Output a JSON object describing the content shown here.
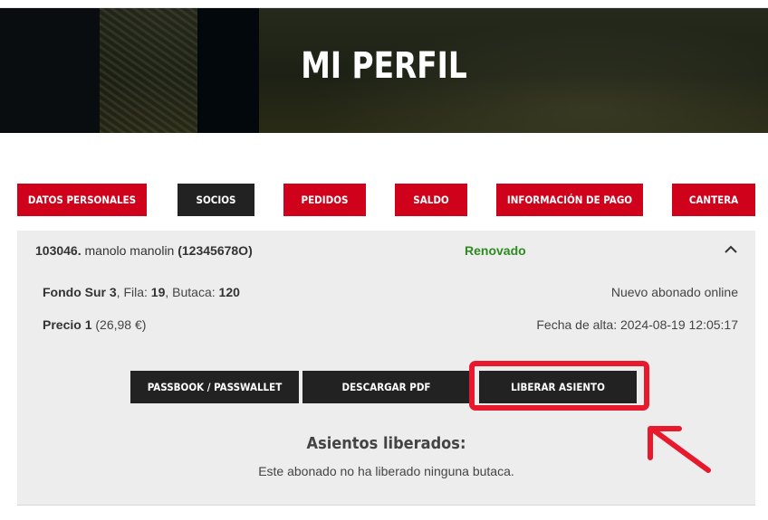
{
  "hero": {
    "title": "MI PERFIL"
  },
  "tabs": [
    {
      "label": "DATOS PERSONALES",
      "active": false
    },
    {
      "label": "SOCIOS",
      "active": true
    },
    {
      "label": "PEDIDOS",
      "active": false
    },
    {
      "label": "SALDO",
      "active": false
    },
    {
      "label": "INFORMACIÓN DE PAGO",
      "active": false
    },
    {
      "label": "CANTERA",
      "active": false
    }
  ],
  "member": {
    "number": "103046.",
    "name": "manolo manolin",
    "id": "(12345678O)",
    "status": "Renovado",
    "status_color": "#2e8b21",
    "seat_zone": "Fondo Sur 3",
    "row_label": ", Fila: ",
    "row": "19",
    "seat_label": ", Butaca: ",
    "seat": "120",
    "subscription_type": "Nuevo abonado online",
    "price_name": "Precio 1",
    "price_value": "(26,98 €)",
    "signup_date": "Fecha de alta: 2024-08-19 12:05:17"
  },
  "actions": {
    "passbook": "PASSBOOK / PASSWALLET",
    "download_pdf": "DESCARGAR PDF",
    "release_seat": "LIBERAR ASIENTO"
  },
  "released": {
    "title": "Asientos liberados:",
    "text": "Este abonado no ha liberado ninguna butaca."
  },
  "colors": {
    "brand_red": "#d0021b",
    "dark": "#222222",
    "highlight": "#e8192c"
  },
  "icons": {
    "collapse": "chevron-up-icon",
    "annotation": "arrow-icon"
  }
}
